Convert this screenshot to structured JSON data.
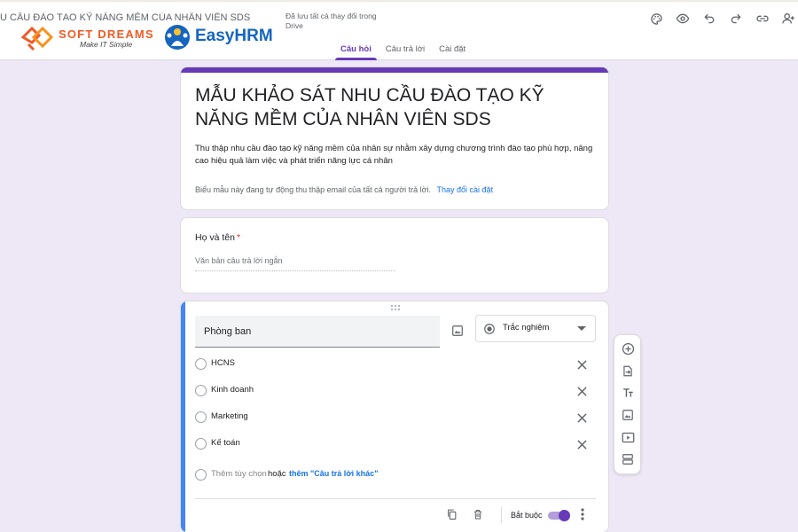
{
  "header": {
    "doc_title": "U CẦU ĐÀO TẠO KỸ NĂNG MỀM CỦA NHÂN VIÊN SDS",
    "save_status": "Đã lưu tất cả thay đổi trong Drive",
    "tabs": [
      {
        "label": "Câu hỏi",
        "active": true
      },
      {
        "label": "Câu trả lời",
        "active": false
      },
      {
        "label": "Cài đặt",
        "active": false
      }
    ],
    "icons": [
      "palette-icon",
      "preview-icon",
      "undo-icon",
      "redo-icon",
      "link-icon",
      "add-collaborator-icon"
    ]
  },
  "logos": {
    "softdreams": {
      "name": "SOFT DREAMS",
      "tagline": "Make IT Simple",
      "color": "#f15a24"
    },
    "easyhrm": {
      "name": "EasyHRM",
      "color": "#1565c0"
    }
  },
  "form": {
    "accent_color": "#673ab7",
    "title": "MẪU KHẢO SÁT NHU CẦU ĐÀO TẠO KỸ NĂNG MỀM CỦA NHÂN VIÊN SDS",
    "description": "Thu thập nhu cầu đào tạo kỹ năng mềm của nhân sự nhằm xây dựng chương trình đào tạo phù hợp, nâng cao hiệu quả làm việc và phát triển năng lực cá nhân",
    "email_note": "Biểu mẫu này đang tự động thu thập email của tất cả người trả lời.",
    "email_link": "Thay đổi cài đặt"
  },
  "question_name": {
    "label": "Họ và tên",
    "required_mark": "*",
    "placeholder": "Văn bản câu trả lời ngắn"
  },
  "question_dept": {
    "title": "Phòng ban",
    "type_label": "Trắc nghiệm",
    "options": [
      "HCNS",
      "Kinh doanh",
      "Marketing",
      "Kế toán"
    ],
    "add_option": "Thêm tùy chọn",
    "or_text": "hoặc",
    "add_other": "thêm \"Câu trả lời khác\"",
    "required_label": "Bắt buộc",
    "required_on": true
  },
  "toolbar": {
    "icons": [
      "add-question-icon",
      "import-questions-icon",
      "add-title-icon",
      "add-image-icon",
      "add-video-icon",
      "add-section-icon"
    ]
  }
}
